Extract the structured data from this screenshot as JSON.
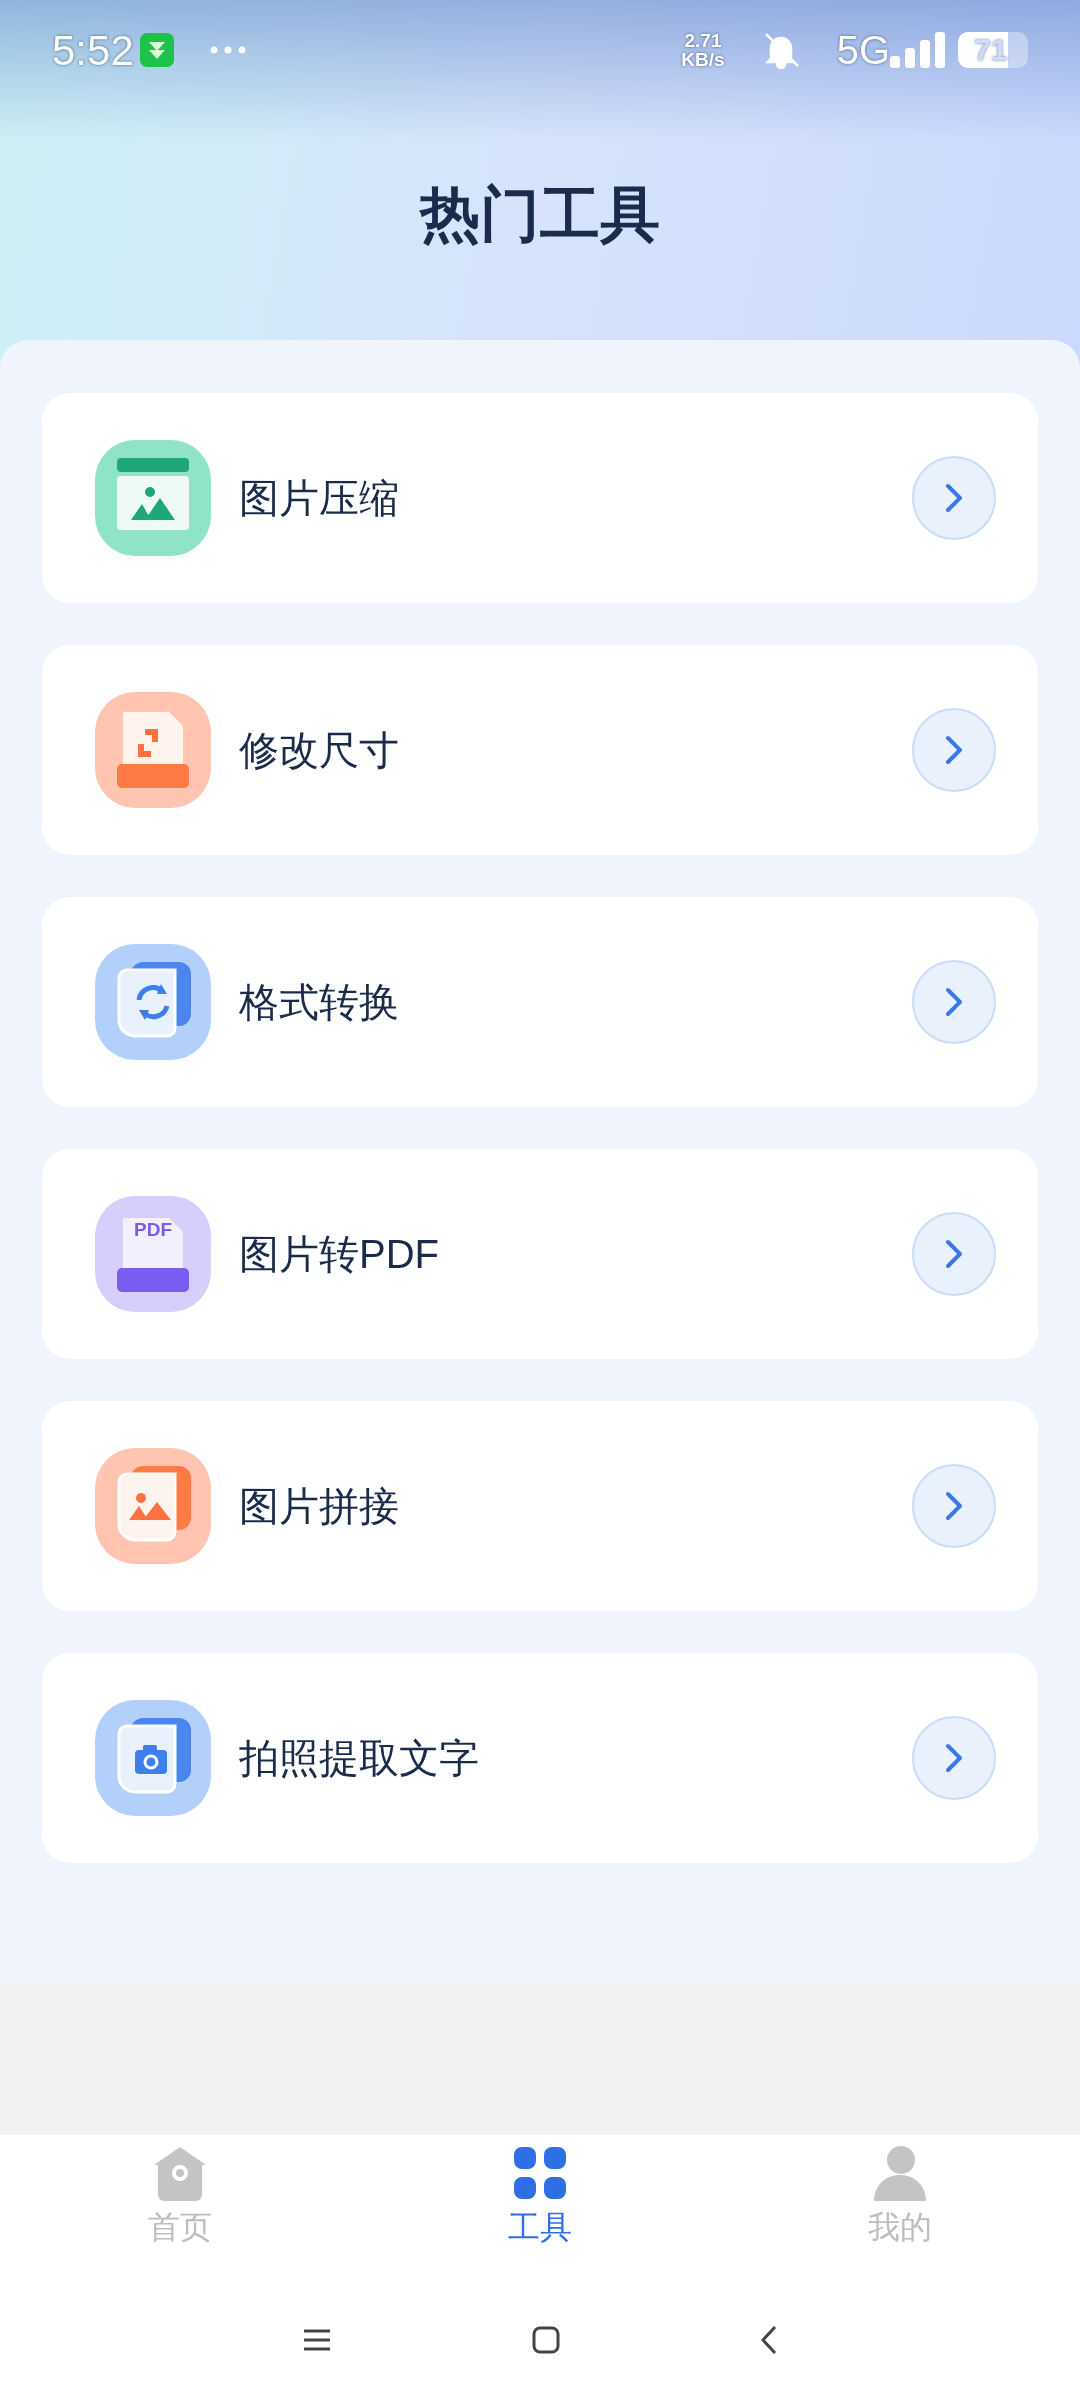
{
  "status_bar": {
    "time": "5:52",
    "net_speed": "2.71",
    "net_unit": "KB/s",
    "network": "5G",
    "battery": "71"
  },
  "title": "热门工具",
  "tools": [
    {
      "kind": "compress",
      "label": "图片压缩"
    },
    {
      "kind": "resize",
      "label": "修改尺寸"
    },
    {
      "kind": "convert",
      "label": "格式转换"
    },
    {
      "kind": "pdf",
      "label": "图片转PDF",
      "icon_text": "PDF"
    },
    {
      "kind": "stitch",
      "label": "图片拼接"
    },
    {
      "kind": "ocr",
      "label": "拍照提取文字"
    }
  ],
  "bottom_nav": [
    {
      "kind": "home",
      "label": "首页",
      "selected": false
    },
    {
      "kind": "tools",
      "label": "工具",
      "selected": true
    },
    {
      "kind": "me",
      "label": "我的",
      "selected": false
    }
  ]
}
